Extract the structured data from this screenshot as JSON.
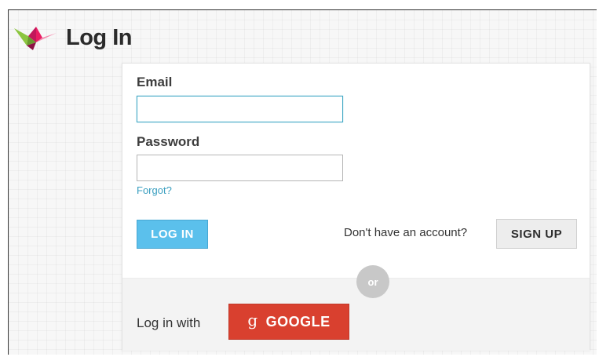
{
  "header": {
    "title": "Log In",
    "logo_icon": "origami-crane-icon"
  },
  "form": {
    "email_label": "Email",
    "email_value": "",
    "password_label": "Password",
    "password_value": "",
    "forgot_link": "Forgot?",
    "login_button": "LOG IN",
    "no_account_text": "Don't have an account?",
    "signup_button": "SIGN UP"
  },
  "social": {
    "or_label": "or",
    "login_with_text": "Log in with",
    "google_icon": "g",
    "google_button": "GOOGLE"
  },
  "colors": {
    "primary": "#5bc0ec",
    "google": "#d9402f",
    "link": "#3a9fc0",
    "focus_border": "#3fa7c4",
    "logo_green": "#8cc63f",
    "logo_magenta": "#c2185b"
  }
}
